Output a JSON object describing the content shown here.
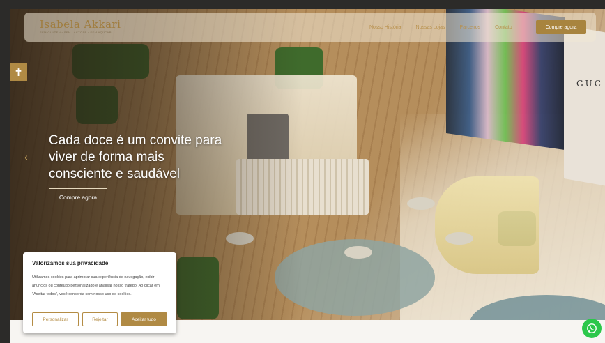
{
  "brand": {
    "name": "Isabela Akkari",
    "tagline": "SEM GLUTEN • SEM LACTOSE • SEM AÇÚCAR"
  },
  "nav": {
    "items": [
      "Nosso História",
      "Nossas Lojas",
      "Parceiros",
      "Contato"
    ],
    "cta": "Compre agora"
  },
  "hero": {
    "headline": "Cada doce é um convite para viver de forma mais consciente e saudável",
    "cta": "Compre agora",
    "mural_text": "GUC"
  },
  "cookie": {
    "title": "Valorizamos sua privacidade",
    "text": "Utilizamos cookies para aprimorar sua experiência de navegação, exibir anúncios ou conteúdo personalizado e analisar nosso tráfego. Ao clicar em \"Aceitar todos\", você concorda com nosso uso de cookies.",
    "buttons": {
      "customize": "Personalizar",
      "reject": "Rejeitar",
      "accept": "Aceitar tudo"
    }
  },
  "icons": {
    "accessibility": "accessibility-icon",
    "prev": "chevron-left-icon",
    "whatsapp": "whatsapp-icon"
  },
  "colors": {
    "accent": "#b08a44",
    "whatsapp": "#2cc74b"
  }
}
